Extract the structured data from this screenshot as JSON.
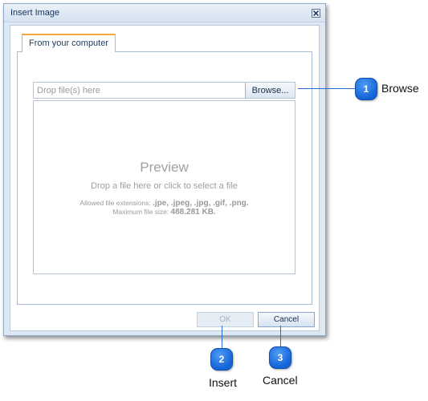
{
  "dialog": {
    "title": "Insert Image",
    "close_icon": "close-icon"
  },
  "tabs": [
    {
      "label": "From your computer",
      "active": true
    }
  ],
  "upload": {
    "placeholder": "Drop file(s) here",
    "browse_label": "Browse..."
  },
  "preview": {
    "title": "Preview",
    "hint": "Drop a file here or click to select a file",
    "extensions_prefix": "Allowed file extensions: ",
    "extensions_value": ".jpe, .jpeg, .jpg, .gif, .png.",
    "max_size_prefix": "Maximum file size: ",
    "max_size_value": "488.281 KB."
  },
  "footer": {
    "ok_label": "OK",
    "ok_enabled": false,
    "cancel_label": "Cancel"
  },
  "callouts": [
    {
      "number": "1",
      "label": "Browse"
    },
    {
      "number": "2",
      "label": "Insert"
    },
    {
      "number": "3",
      "label": "Cancel"
    }
  ],
  "colors": {
    "accent_tab": "#f0a63c",
    "callout_badge": "#1565d8",
    "dialog_background": "#dde8f4"
  }
}
